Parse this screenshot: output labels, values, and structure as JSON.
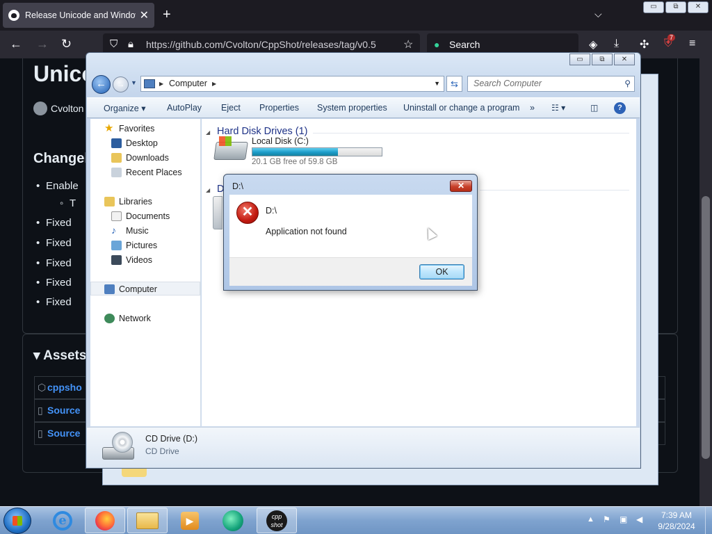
{
  "browser": {
    "tab_title": "Release Unicode and Windows",
    "tab_close": "✕",
    "new_tab": "+",
    "list_all_tabs": "⌵",
    "url": "https://github.com/Cvolton/CppShot/releases/tag/v0.5",
    "search_label": "Search",
    "extension_badge": "7",
    "window_buttons": [
      "▭",
      "⧉",
      "✕"
    ]
  },
  "github": {
    "title": "Unico",
    "author": "Cvolton",
    "changelog_heading": "Changel",
    "list_items": [
      "Enable",
      "Fixed",
      "Fixed",
      "Fixed",
      "Fixed",
      "Fixed"
    ],
    "sub_item": "T",
    "assets_heading": "Assets",
    "assets": [
      "cppsho",
      "Source",
      "Source"
    ]
  },
  "explorer": {
    "breadcrumb": "Computer",
    "search_placeholder": "Search Computer",
    "caption_buttons": [
      "▭",
      "⧉",
      "✕"
    ],
    "toolbar": {
      "organize": "Organize ▾",
      "autoplay": "AutoPlay",
      "eject": "Eject",
      "properties": "System properties",
      "properties_plain": "Properties",
      "uninstall": "Uninstall or change a program",
      "more": "»"
    },
    "nav": {
      "favorites": "Favorites",
      "desktop": "Desktop",
      "downloads": "Downloads",
      "recent": "Recent Places",
      "libraries": "Libraries",
      "documents": "Documents",
      "music": "Music",
      "pictures": "Pictures",
      "videos": "Videos",
      "computer": "Computer",
      "network": "Network"
    },
    "groups": {
      "hdd": "Hard Disk Drives (1)",
      "removable": "D"
    },
    "drive": {
      "name": "Local Disk (C:)",
      "free_text": "20.1 GB free of 59.8 GB",
      "used_fraction": 0.66
    },
    "details": {
      "name": "CD Drive (D:)",
      "type": "CD Drive"
    }
  },
  "dialog": {
    "title": "D:\\",
    "close": "✕",
    "icon_glyph": "✕",
    "heading": "D:\\",
    "message": "Application not found",
    "ok": "OK"
  },
  "taskbar": {
    "cpp_label": "cpp shot",
    "time": "7:39 AM",
    "date": "9/28/2024"
  }
}
